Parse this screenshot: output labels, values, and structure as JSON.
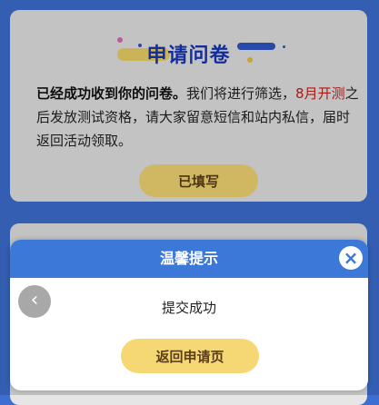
{
  "card": {
    "title": "申请问卷",
    "message_bold": "已经成功收到你的问卷。",
    "message_part1": "我们将进行筛选，",
    "message_red": "8月开测",
    "message_part2": "之后发放测试资格，请大家留意短信和站内私信，届时返回活动领取。",
    "filled_button": "已填写"
  },
  "modal": {
    "title": "温馨提示",
    "close_icon": "×",
    "body": "提交成功",
    "return_button": "返回申请页",
    "back_icon": "‹"
  },
  "colors": {
    "background": "#3d6fd0",
    "modal_header": "#3c78d8",
    "button": "#f5d873",
    "title": "#1736b8",
    "highlight": "#c8201d"
  }
}
